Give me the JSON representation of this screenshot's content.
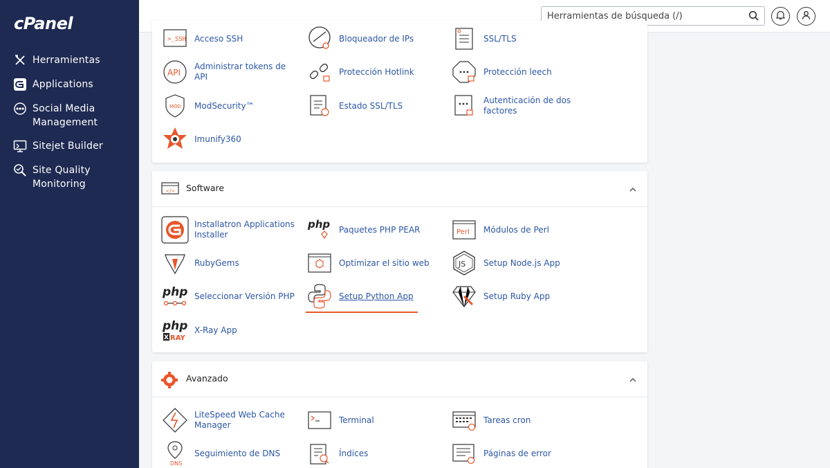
{
  "app": {
    "logo": "cPanel",
    "accent": "#e8562a",
    "link_color": "#2c57a6",
    "sidebar_bg": "#1e2a52"
  },
  "sidebar": {
    "items": [
      {
        "label": "Herramientas",
        "icon": "tools-icon"
      },
      {
        "label": "Applications",
        "icon": "applications-icon"
      },
      {
        "label": "Social Media Management",
        "icon": "social-media-icon"
      },
      {
        "label": "Sitejet Builder",
        "icon": "sitejet-icon"
      },
      {
        "label": "Site Quality Monitoring",
        "icon": "site-quality-icon"
      }
    ]
  },
  "header": {
    "search_placeholder": "Herramientas de búsqueda (/)"
  },
  "security": {
    "items": [
      [
        "Acceso SSH",
        "Bloqueador de IPs",
        "SSL/TLS"
      ],
      [
        "Administrar tokens de API",
        "Protección Hotlink",
        "Protección leech"
      ],
      [
        "ModSecurity™",
        "Estado SSL/TLS",
        "Autenticación de dos factores"
      ],
      [
        "Imunify360"
      ]
    ],
    "icon_texts": {
      "ssh": ">_SSH",
      "api": "API",
      "mod": "MOD"
    }
  },
  "software": {
    "title": "Software",
    "items": [
      [
        "Installatron Applications Installer",
        "Paquetes PHP PEAR",
        "Módulos de Perl"
      ],
      [
        "RubyGems",
        "Optimizar el sitio web",
        "Setup Node.js App"
      ],
      [
        "Seleccionar Versión PHP",
        "Setup Python App",
        "Setup Ruby App"
      ],
      [
        "X-Ray App"
      ]
    ],
    "active_item": "Setup Python App",
    "icon_texts": {
      "php": "php",
      "perl": "Perl",
      "js": "JS",
      "xray": "XRAY"
    }
  },
  "avanzado": {
    "title": "Avanzado",
    "items": [
      [
        "LiteSpeed Web Cache Manager",
        "Terminal",
        "Tareas cron"
      ],
      [
        "Seguimiento de DNS",
        "Índices",
        "Páginas de error"
      ]
    ],
    "icon_texts": {
      "dns": "DNS"
    }
  }
}
